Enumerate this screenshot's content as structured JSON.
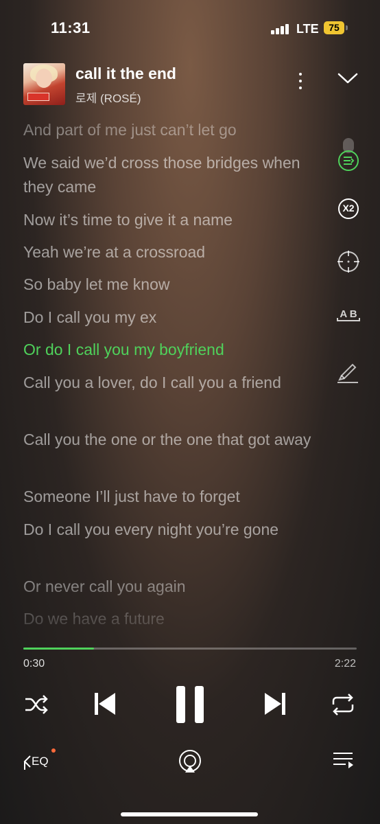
{
  "status_bar": {
    "time": "11:31",
    "network": "LTE",
    "battery": "75"
  },
  "player": {
    "title": "call it the end",
    "artist": "로제 (ROSÉ)"
  },
  "lyrics": [
    {
      "text": "And part of me just can’t let go",
      "current": false
    },
    {
      "text": "We said we’d cross those bridges when they came",
      "current": false
    },
    {
      "text": "Now it’s time to give it a name",
      "current": false
    },
    {
      "text": "Yeah we’re at a crossroad",
      "current": false
    },
    {
      "text": "So baby let me know",
      "current": false
    },
    {
      "text": "Do I call you my ex",
      "current": false
    },
    {
      "text": "Or do I call you my boyfriend",
      "current": true
    },
    {
      "text": "Call you a lover, do I call you a friend",
      "current": false
    },
    {
      "text": "Call you the one or the one that got away",
      "current": false
    },
    {
      "text": "Someone I’ll just have to forget",
      "current": false
    },
    {
      "text": "Do I call you every night you’re gone",
      "current": false
    },
    {
      "text": "Or never call you again",
      "current": false
    },
    {
      "text": "Do we have a future",
      "current": false
    }
  ],
  "side_tools": {
    "speed_label": "X2",
    "ab_label": "A B"
  },
  "playback": {
    "current_time": "0:30",
    "total_time": "2:22",
    "progress_fraction": 0.2113
  },
  "bottom": {
    "eq_label": "EQ"
  },
  "colors": {
    "accent": "#4fd25b",
    "battery": "#f0c531",
    "eq_dot": "#ff6a3a"
  },
  "icons": [
    "more-icon",
    "chevron-down-icon",
    "lyrics-sync-icon",
    "speed-icon",
    "target-icon",
    "ab-repeat-icon",
    "highlight-icon",
    "shuffle-icon",
    "previous-icon",
    "pause-icon",
    "next-icon",
    "repeat-icon",
    "eq-icon",
    "airplay-icon",
    "playlist-icon"
  ]
}
